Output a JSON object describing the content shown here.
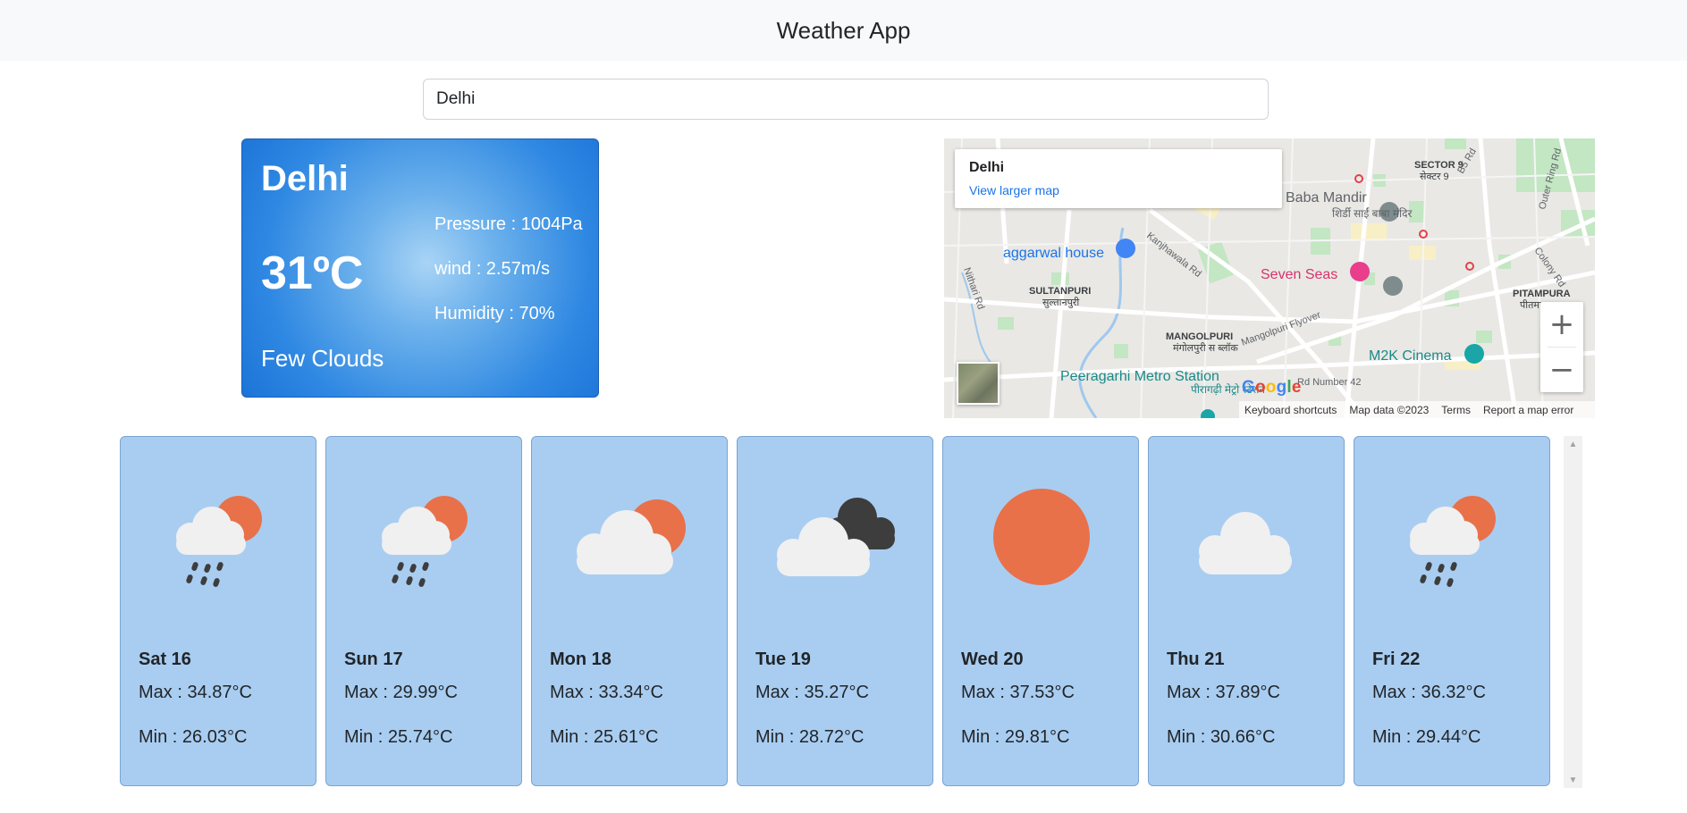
{
  "header": {
    "title": "Weather App"
  },
  "search": {
    "value": "Delhi"
  },
  "current": {
    "city": "Delhi",
    "temperature": "31ºC",
    "description": "Few Clouds",
    "pressure": "Pressure : 1004Pa",
    "wind": "wind : 2.57m/s",
    "humidity": "Humidity : 70%"
  },
  "map": {
    "place": "Delhi",
    "link": "View larger map",
    "zoom_in": "+",
    "zoom_out": "−",
    "google": "Google",
    "keyboard": "Keyboard shortcuts",
    "mapdata": "Map data ©2023",
    "terms": "Terms",
    "report": "Report a map error",
    "labels": {
      "aggarwal": "aggarwal house",
      "seven_seas": "Seven Seas",
      "baba": "Baba Mandir",
      "baba_hi": "शिर्डी साईं बाबा मंदिर",
      "sector9": "SECTOR 9",
      "sector9_hi": "सेक्टर 9",
      "sultanpuri": "SULTANPURI",
      "sultanpuri_hi": "सुल्तानपुरी",
      "mangolpuri": "MANGOLPURI",
      "mangolpuri_hi": "मंगोलपुरी स ब्लॉक",
      "pitampura": "PITAMPURA",
      "pitampura_hi": "पीतमपुरा",
      "peeragarhi": "Peeragarhi Metro Station",
      "peeragarhi_hi": "पीरागढ़ी मेट्रो स्टेशन",
      "m2k": "M2K Cinema",
      "kanjhawala": "Kanjhawala Rd",
      "nithari": "Nithari Rd",
      "mangolpuri_flyover": "Mangolpuri Flyover",
      "rd42": "Rd Number 42",
      "b5": "B5 Rd",
      "outer_ring": "Outer Ring Rd",
      "colony": "Colony Rd"
    }
  },
  "colors": {
    "sun": "#e8714a",
    "cloud": "#f0f0f0",
    "dark_cloud": "#3d3d3d",
    "rain": "#3d3d3d",
    "card": "#a9cdf1",
    "current_card": "#2f88e2"
  },
  "forecast": [
    {
      "day": "Sat 16",
      "max": "Max : 34.87°C",
      "min": "Min : 26.03°C",
      "icon": "rain-sun-cloud-icon"
    },
    {
      "day": "Sun 17",
      "max": "Max : 29.99°C",
      "min": "Min : 25.74°C",
      "icon": "rain-sun-cloud-icon"
    },
    {
      "day": "Mon 18",
      "max": "Max : 33.34°C",
      "min": "Min : 25.61°C",
      "icon": "partly-cloudy-icon"
    },
    {
      "day": "Tue 19",
      "max": "Max : 35.27°C",
      "min": "Min : 28.72°C",
      "icon": "broken-clouds-icon"
    },
    {
      "day": "Wed 20",
      "max": "Max : 37.53°C",
      "min": "Min : 29.81°C",
      "icon": "sun-icon"
    },
    {
      "day": "Thu 21",
      "max": "Max : 37.89°C",
      "min": "Min : 30.66°C",
      "icon": "cloud-icon"
    },
    {
      "day": "Fri 22",
      "max": "Max : 36.32°C",
      "min": "Min : 29.44°C",
      "icon": "rain-sun-cloud-icon"
    }
  ]
}
